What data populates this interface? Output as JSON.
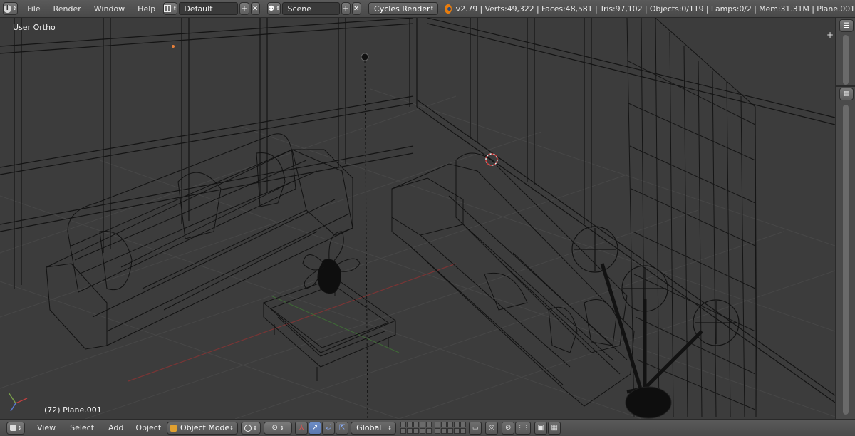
{
  "topbar": {
    "menus": [
      "File",
      "Render",
      "Window",
      "Help"
    ],
    "screen_layout": "Default",
    "scene": "Scene",
    "render_engine": "Cycles Render",
    "stats": "v2.79 | Verts:49,322 | Faces:48,581 | Tris:97,102 | Objects:0/119 | Lamps:0/2 | Mem:31.31M | Plane.001"
  },
  "viewport": {
    "view_label": "User Ortho",
    "object_label": "(72) Plane.001"
  },
  "bottombar": {
    "menus": [
      "View",
      "Select",
      "Add",
      "Object"
    ],
    "mode": "Object Mode",
    "orientation": "Global"
  },
  "colors": {
    "header_bg": "#4f4f4f",
    "viewport_bg": "#3c3c3c",
    "grid": "#4a4a4a",
    "x_axis": "#8a3a3a",
    "y_axis": "#4c7a3c",
    "wire": "#111111"
  }
}
